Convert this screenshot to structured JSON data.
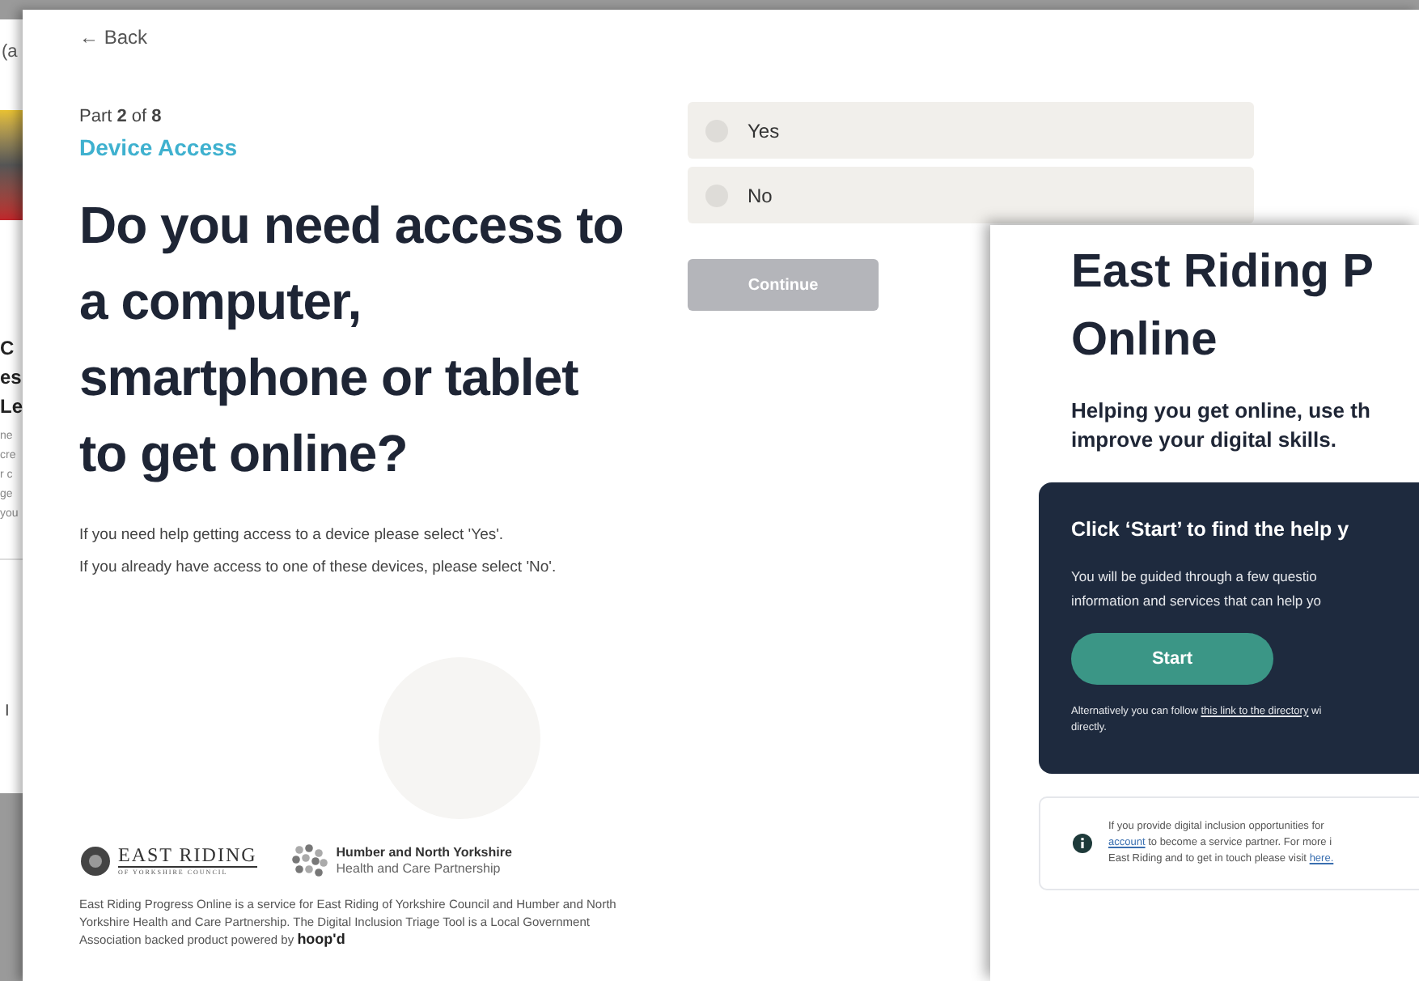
{
  "background_window": {
    "top_text": "(a",
    "heading_fragments": [
      "C",
      "es",
      "Le"
    ],
    "body_fragments": [
      "ne",
      "cre",
      "r c",
      "ge",
      "you"
    ],
    "bottom_text": "I"
  },
  "main_window": {
    "back_link": "← Back",
    "progress": "Part **2** of **8**",
    "section_title": "Device Access",
    "question": "Do you need access to a computer, smartphone or tablet to get online?",
    "help_lines": [
      "If you need help getting access to a device please select 'Yes'.",
      "If you already have access to one of these devices, please select 'No'."
    ],
    "options": [
      {
        "label": "Yes",
        "selected": false
      },
      {
        "label": "No",
        "selected": false
      }
    ],
    "continue_button": {
      "label": "Continue",
      "disabled": true
    },
    "footer": {
      "council_logo": "EAST RIDING",
      "council_logo_sub": "OF YORKSHIRE COUNCIL",
      "partner_title": "Humber and North Yorkshire",
      "partner_sub": "Health and Care Partnership",
      "text": "East Riding Progress Online is a service for East Riding of Yorkshire Council and Humber and North Yorkshire Health and Care Partnership. The Digital Inclusion Triage Tool is a Local Government Association backed product powered by",
      "brand": "hoop'd"
    }
  },
  "front_window": {
    "title_lines": [
      "East Riding P",
      "Online"
    ],
    "subtitle_lines": [
      "Helping you get online, use th",
      "improve your digital skills."
    ],
    "card": {
      "heading": "Click ‘Start’ to find the help y",
      "body_lines": [
        "You will be guided through a few questio",
        "information and services that can help yo"
      ],
      "button": "Start",
      "alt_before": "Alternatively you can follow",
      "alt_link": "this link to the directory",
      "alt_after": "wi",
      "alt_line2": "directly."
    },
    "info": {
      "line1": "If you provide digital inclusion opportunities for",
      "line2_link": "account",
      "line2_rest": "to become a service partner. For more i",
      "line3": "East Riding and to get in touch please visit",
      "line3_link": "here."
    }
  }
}
